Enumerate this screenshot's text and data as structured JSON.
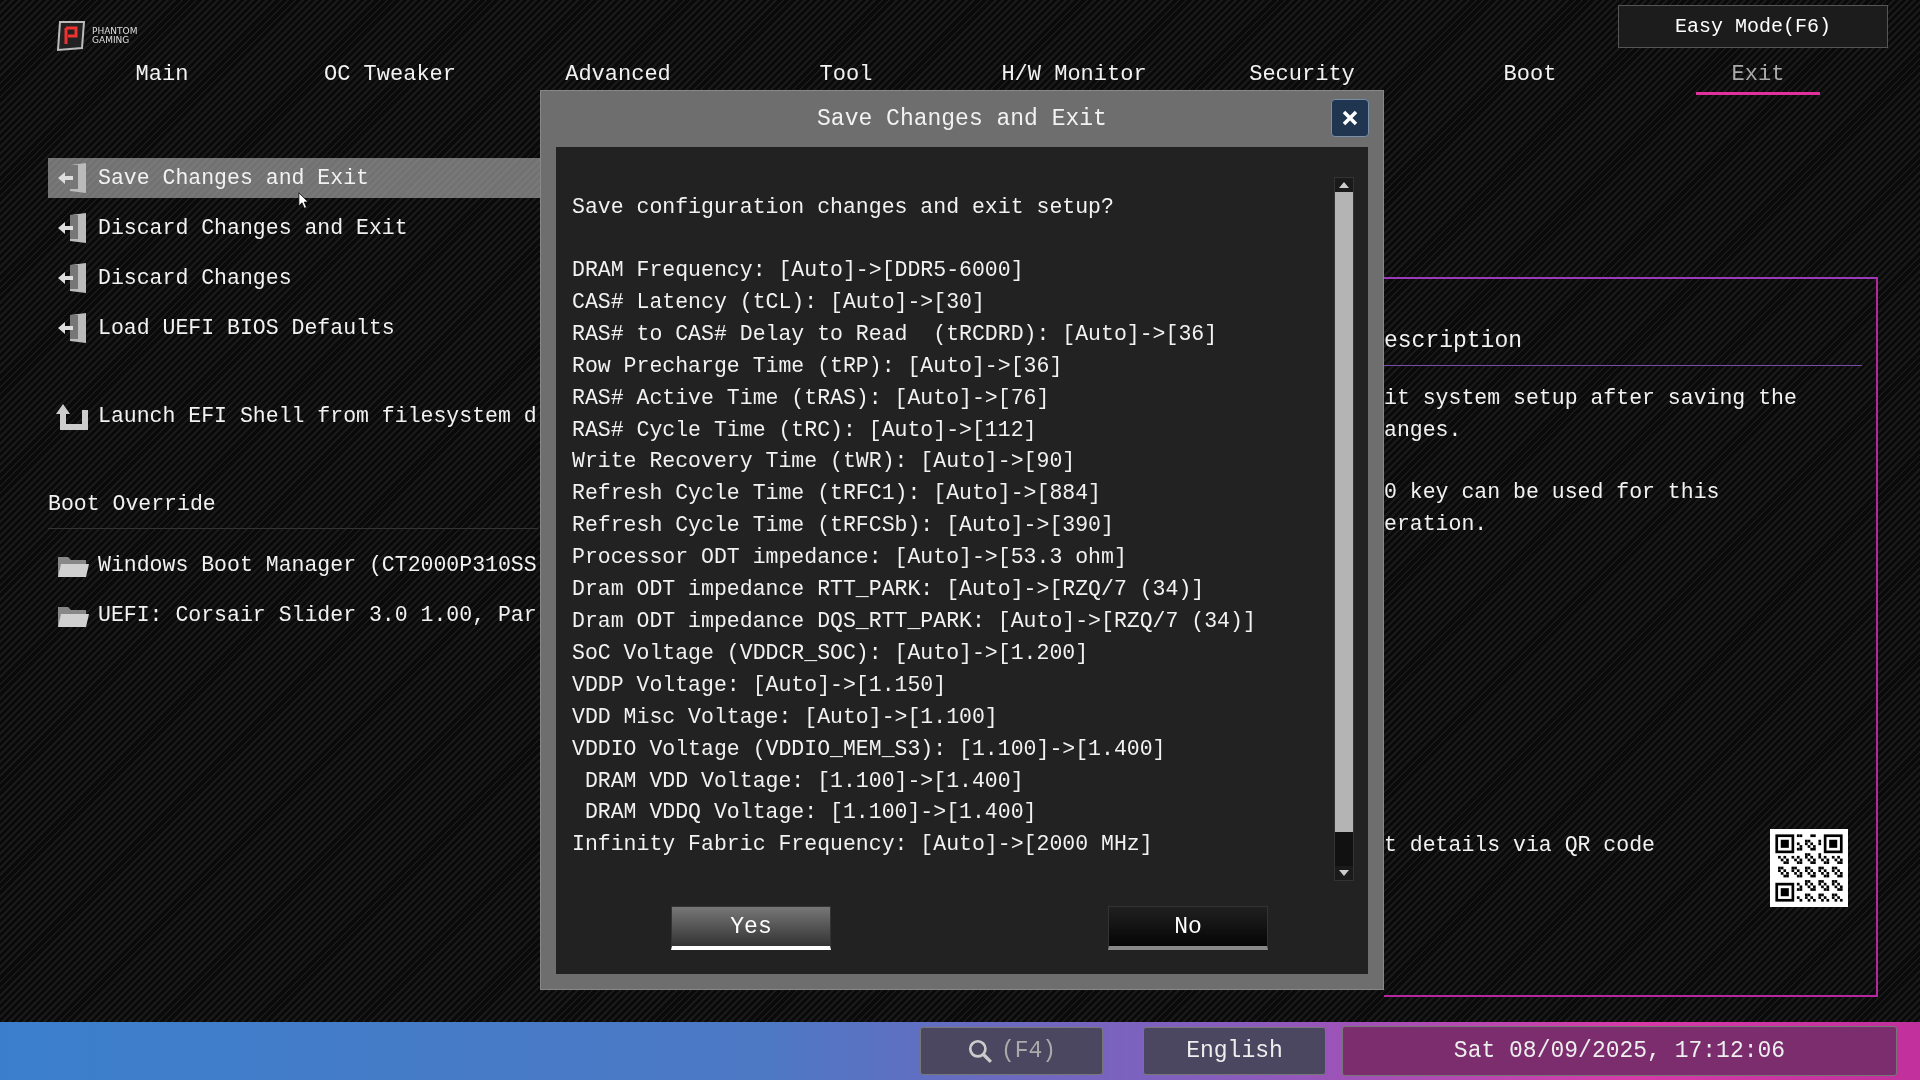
{
  "logo": {
    "lines": [
      "PHANTOM",
      "GAMING"
    ]
  },
  "easy_mode_button": "Easy Mode(F6)",
  "tabs": [
    {
      "label": "Main",
      "selected": false
    },
    {
      "label": "OC Tweaker",
      "selected": false
    },
    {
      "label": "Advanced",
      "selected": false
    },
    {
      "label": "Tool",
      "selected": false
    },
    {
      "label": "H/W Monitor",
      "selected": false
    },
    {
      "label": "Security",
      "selected": false
    },
    {
      "label": "Boot",
      "selected": false
    },
    {
      "label": "Exit",
      "selected": true
    }
  ],
  "exit_menu": [
    {
      "kind": "action",
      "label": "Save Changes and Exit",
      "selected": true
    },
    {
      "kind": "action",
      "label": "Discard Changes and Exit",
      "selected": false
    },
    {
      "kind": "action",
      "label": "Discard Changes",
      "selected": false
    },
    {
      "kind": "action",
      "label": "Load UEFI BIOS Defaults",
      "selected": false
    },
    {
      "kind": "shell",
      "label": "Launch EFI Shell from filesystem d",
      "selected": false
    },
    {
      "kind": "heading",
      "label": "Boot Override"
    },
    {
      "kind": "device",
      "label": "Windows Boot Manager (CT2000P310SS",
      "selected": false
    },
    {
      "kind": "device",
      "label": "UEFI: Corsair Slider 3.0 1.00, Par",
      "selected": false
    }
  ],
  "dialog": {
    "title": "Save Changes and Exit",
    "message": "Save configuration changes and exit setup?",
    "changes": [
      "DRAM Frequency: [Auto]->[DDR5-6000]",
      "CAS# Latency (tCL): [Auto]->[30]",
      "RAS# to CAS# Delay to Read  (tRCDRD): [Auto]->[36]",
      "Row Precharge Time (tRP): [Auto]->[36]",
      "RAS# Active Time (tRAS): [Auto]->[76]",
      "RAS# Cycle Time (tRC): [Auto]->[112]",
      "Write Recovery Time (tWR): [Auto]->[90]",
      "Refresh Cycle Time (tRFC1): [Auto]->[884]",
      "Refresh Cycle Time (tRFCSb): [Auto]->[390]",
      "Processor ODT impedance: [Auto]->[53.3 ohm]",
      "Dram ODT impedance RTT_PARK: [Auto]->[RZQ/7 (34)]",
      "Dram ODT impedance DQS_RTT_PARK: [Auto]->[RZQ/7 (34)]",
      "SoC Voltage (VDDCR_SOC): [Auto]->[1.200]",
      "VDDP Voltage: [Auto]->[1.150]",
      "VDD Misc Voltage: [Auto]->[1.100]",
      "VDDIO Voltage (VDDIO_MEM_S3): [1.100]->[1.400]",
      " DRAM VDD Voltage: [1.100]->[1.400]",
      " DRAM VDDQ Voltage: [1.100]->[1.400]",
      "Infinity Fabric Frequency: [Auto]->[2000 MHz]"
    ],
    "buttons": [
      {
        "label": "Yes",
        "selected": true
      },
      {
        "label": "No",
        "selected": false
      }
    ]
  },
  "description_panel": {
    "title": "escription",
    "paragraphs": [
      [
        "it system setup after saving the",
        "anges."
      ],
      [
        "0 key can be used for this",
        "eration."
      ]
    ],
    "qr_label": "t details via QR code"
  },
  "status_bar": {
    "search_key": "(F4)",
    "language": "English",
    "datetime": "Sat 08/09/2025, 17:12:06"
  }
}
